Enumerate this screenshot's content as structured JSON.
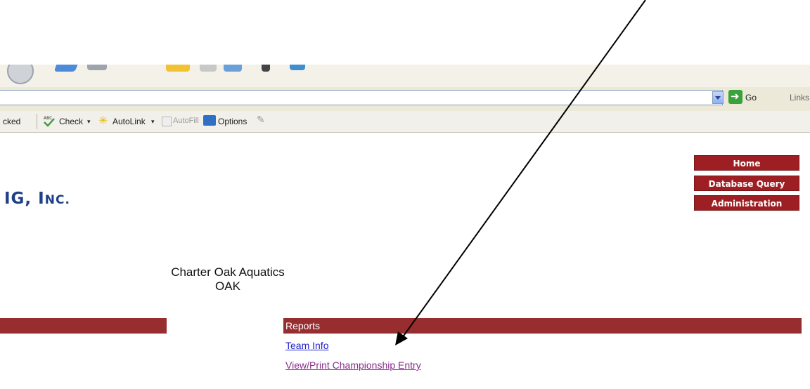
{
  "browser": {
    "go_label": "Go",
    "links_label": "Links"
  },
  "google_toolbar": {
    "blocked_label": "cked",
    "check_label": "Check",
    "autolink_label": "AutoLink",
    "autofill_label": "AutoFill",
    "options_label": "Options",
    "dropdown_glyph": "▾"
  },
  "logo": {
    "text_part1": "IG, I",
    "text_part2": "NC."
  },
  "nav": {
    "home": "Home",
    "database_query": "Database Query",
    "administration": "Administration"
  },
  "team": {
    "name": "Charter Oak Aquatics",
    "code": "OAK"
  },
  "reports": {
    "header": "Reports",
    "team_info": "Team Info",
    "championship_entry": "View/Print Championship Entry"
  },
  "colors": {
    "nav_red": "#9e1f23",
    "bar_red": "#982d2f",
    "logo_blue": "#1f3f86",
    "link_blue": "#2222cc",
    "link_visited": "#8a2b8a"
  }
}
